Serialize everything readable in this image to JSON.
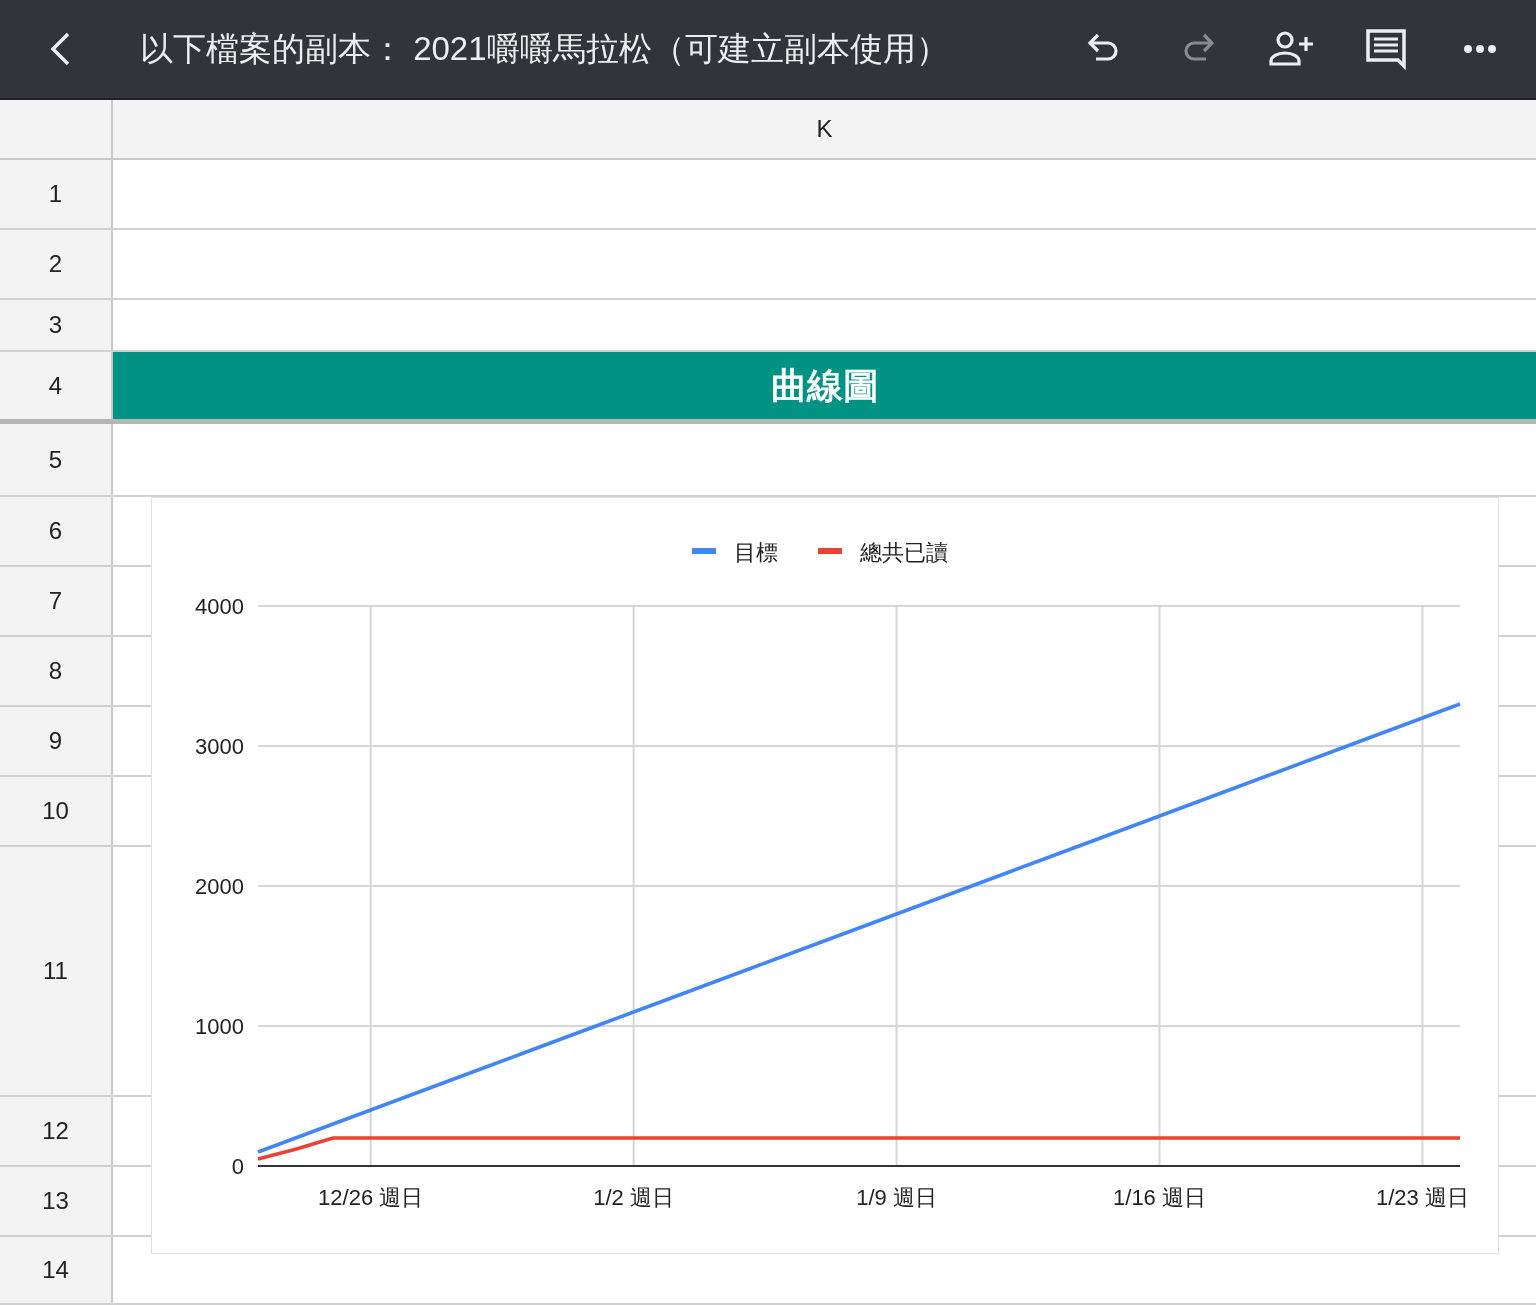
{
  "toolbar": {
    "title": "以下檔案的副本： 2021嚼嚼馬拉松（可建立副本使用）",
    "actions": [
      {
        "kind": "undo",
        "disabled": false
      },
      {
        "kind": "redo",
        "disabled": true
      },
      {
        "kind": "share",
        "disabled": false
      },
      {
        "kind": "comment",
        "disabled": false
      },
      {
        "kind": "more",
        "disabled": false
      }
    ]
  },
  "sheet": {
    "columns": [
      "K"
    ],
    "rows": [
      {
        "label": "1"
      },
      {
        "label": "2"
      },
      {
        "label": "3"
      },
      {
        "label": "4",
        "banner": "曲線圖"
      },
      {
        "label": "5"
      },
      {
        "label": "6"
      },
      {
        "label": "7"
      },
      {
        "label": "8"
      },
      {
        "label": "9"
      },
      {
        "label": "10"
      },
      {
        "label": "11"
      },
      {
        "label": "12"
      },
      {
        "label": "13"
      },
      {
        "label": "14"
      }
    ],
    "chart_data": {
      "type": "line",
      "categories": [
        null,
        null,
        null,
        "12/26 週日",
        null,
        null,
        null,
        null,
        null,
        null,
        "1/2 週日",
        null,
        null,
        null,
        null,
        null,
        null,
        "1/9 週日",
        null,
        null,
        null,
        null,
        null,
        null,
        "1/16 週日",
        null,
        null,
        null,
        null,
        null,
        null,
        "1/23 週日",
        null
      ],
      "grid": true,
      "legend": "top",
      "series": [
        {
          "name": "目標",
          "color": "#4285f4",
          "values": [
            100,
            200,
            300,
            400,
            500,
            600,
            700,
            800,
            900,
            1000,
            1100,
            1200,
            1300,
            1400,
            1500,
            1600,
            1700,
            1800,
            1900,
            2000,
            2100,
            2200,
            2300,
            2400,
            2500,
            2600,
            2700,
            2800,
            2900,
            3000,
            3100,
            3200,
            3300
          ]
        },
        {
          "name": "總共已讀",
          "color": "#ea4335",
          "values": [
            50,
            120,
            200,
            200,
            200,
            200,
            200,
            200,
            200,
            200,
            200,
            200,
            200,
            200,
            200,
            200,
            200,
            200,
            200,
            200,
            200,
            200,
            200,
            200,
            200,
            200,
            200,
            200,
            200,
            200,
            200,
            200,
            200
          ]
        }
      ],
      "ylim": [
        0,
        4000
      ],
      "yticks": [
        0,
        1000,
        2000,
        3000,
        4000
      ]
    }
  }
}
